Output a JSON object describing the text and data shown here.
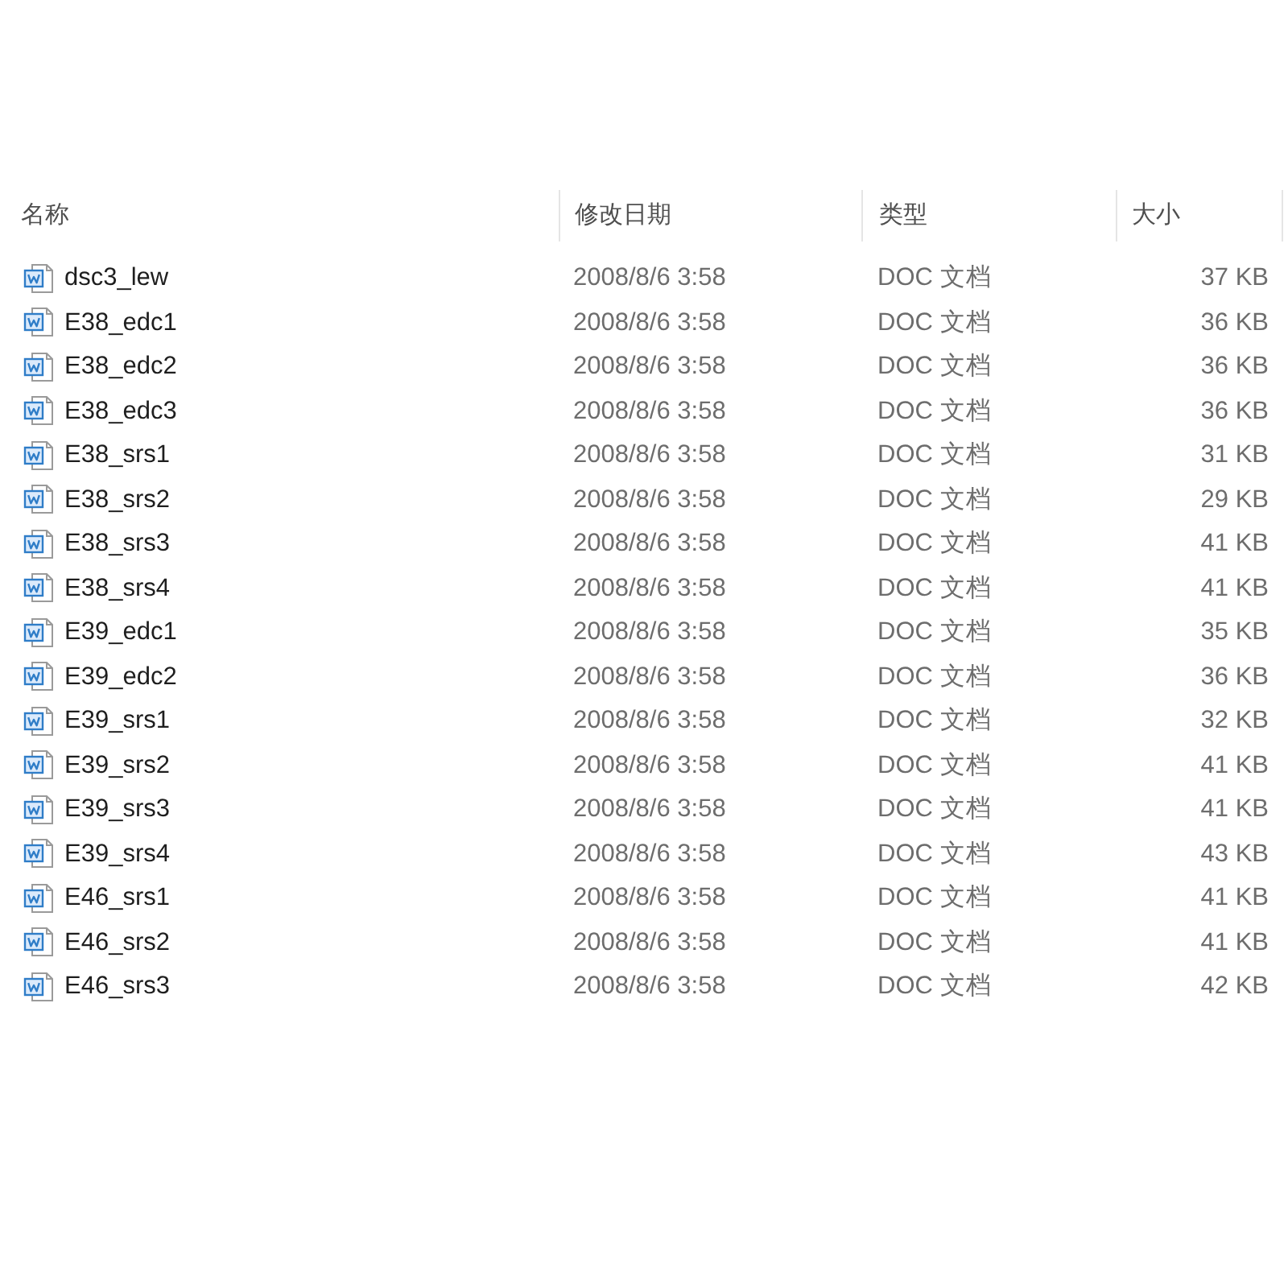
{
  "table": {
    "columns": [
      {
        "label": "名称"
      },
      {
        "label": "修改日期"
      },
      {
        "label": "类型"
      },
      {
        "label": "大小"
      }
    ],
    "rows": [
      {
        "name": "dsc3_lew",
        "modified": "2008/8/6 3:58",
        "type": "DOC 文档",
        "size": "37 KB"
      },
      {
        "name": "E38_edc1",
        "modified": "2008/8/6 3:58",
        "type": "DOC 文档",
        "size": "36 KB"
      },
      {
        "name": "E38_edc2",
        "modified": "2008/8/6 3:58",
        "type": "DOC 文档",
        "size": "36 KB"
      },
      {
        "name": "E38_edc3",
        "modified": "2008/8/6 3:58",
        "type": "DOC 文档",
        "size": "36 KB"
      },
      {
        "name": "E38_srs1",
        "modified": "2008/8/6 3:58",
        "type": "DOC 文档",
        "size": "31 KB"
      },
      {
        "name": "E38_srs2",
        "modified": "2008/8/6 3:58",
        "type": "DOC 文档",
        "size": "29 KB"
      },
      {
        "name": "E38_srs3",
        "modified": "2008/8/6 3:58",
        "type": "DOC 文档",
        "size": "41 KB"
      },
      {
        "name": "E38_srs4",
        "modified": "2008/8/6 3:58",
        "type": "DOC 文档",
        "size": "41 KB"
      },
      {
        "name": "E39_edc1",
        "modified": "2008/8/6 3:58",
        "type": "DOC 文档",
        "size": "35 KB"
      },
      {
        "name": "E39_edc2",
        "modified": "2008/8/6 3:58",
        "type": "DOC 文档",
        "size": "36 KB"
      },
      {
        "name": "E39_srs1",
        "modified": "2008/8/6 3:58",
        "type": "DOC 文档",
        "size": "32 KB"
      },
      {
        "name": "E39_srs2",
        "modified": "2008/8/6 3:58",
        "type": "DOC 文档",
        "size": "41 KB"
      },
      {
        "name": "E39_srs3",
        "modified": "2008/8/6 3:58",
        "type": "DOC 文档",
        "size": "41 KB"
      },
      {
        "name": "E39_srs4",
        "modified": "2008/8/6 3:58",
        "type": "DOC 文档",
        "size": "43 KB"
      },
      {
        "name": "E46_srs1",
        "modified": "2008/8/6 3:58",
        "type": "DOC 文档",
        "size": "41 KB"
      },
      {
        "name": "E46_srs2",
        "modified": "2008/8/6 3:58",
        "type": "DOC 文档",
        "size": "41 KB"
      },
      {
        "name": "E46_srs3",
        "modified": "2008/8/6 3:58",
        "type": "DOC 文档",
        "size": "42 KB"
      }
    ]
  }
}
